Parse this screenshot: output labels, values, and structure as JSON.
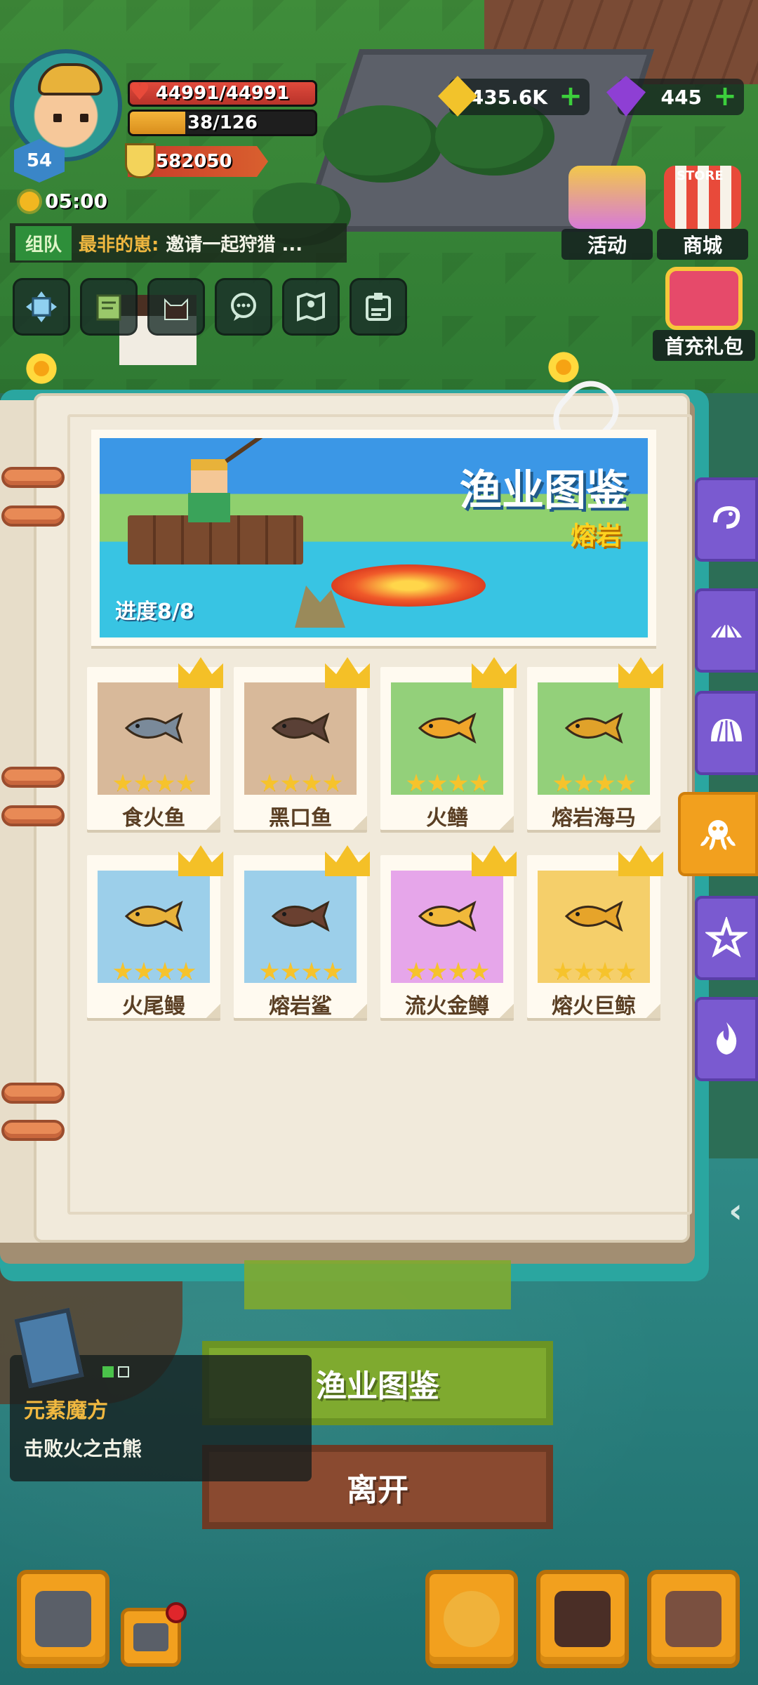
{
  "player": {
    "level": "54",
    "hp": "44991/44991",
    "energy": "38/126",
    "power": "582050",
    "timer": "05:00"
  },
  "currency": {
    "gold": "435.6K",
    "gems": "445"
  },
  "team": {
    "tag": "组队",
    "user": "最非的崽:",
    "message": "邀请一起狩猎 ..."
  },
  "hud_buttons": [
    "scale-icon",
    "map-book-icon",
    "cat-icon",
    "chat-icon",
    "map-icon",
    "badge-icon"
  ],
  "side_shops": {
    "events": "活动",
    "store_sign": "STORE",
    "store": "商城",
    "first_recharge": "首充礼包"
  },
  "journal": {
    "title": "渔业图鉴",
    "subtitle": "熔岩",
    "progress": "进度8/8",
    "fish": [
      {
        "name": "食火鱼",
        "stars": 4,
        "tile": "#d8b99a",
        "fish_color": "#7a8a9a"
      },
      {
        "name": "黑口鱼",
        "stars": 4,
        "tile": "#d8b99a",
        "fish_color": "#5a4036"
      },
      {
        "name": "火鳝",
        "stars": 4,
        "tile": "#93d07a",
        "fish_color": "#f0a52a"
      },
      {
        "name": "熔岩海马",
        "stars": 4,
        "tile": "#93d07a",
        "fish_color": "#e0a22a"
      },
      {
        "name": "火尾鳗",
        "stars": 4,
        "tile": "#9ccfea",
        "fish_color": "#e8b23a"
      },
      {
        "name": "熔岩鲨",
        "stars": 4,
        "tile": "#9ccfea",
        "fish_color": "#6a4030"
      },
      {
        "name": "流火金鳟",
        "stars": 4,
        "tile": "#e6a6ea",
        "fish_color": "#f1b93a"
      },
      {
        "name": "熔火巨鲸",
        "stars": 4,
        "tile": "#f5cf6a",
        "fish_color": "#e6a42a"
      }
    ]
  },
  "side_tabs": [
    {
      "icon": "shrimp-icon",
      "active": false
    },
    {
      "icon": "shell-icon",
      "active": false
    },
    {
      "icon": "scallop-icon",
      "active": false
    },
    {
      "icon": "octopus-icon",
      "active": true
    },
    {
      "icon": "starfish-icon",
      "active": false
    },
    {
      "icon": "flame-icon",
      "active": false
    }
  ],
  "bottom": {
    "journal_button": "渔业图鉴",
    "leave_button": "离开"
  },
  "quest": {
    "title": "元素魔方",
    "description": "击败火之古熊"
  },
  "colors": {
    "active_tab": "#f2a01e",
    "inactive_tab": "#7a5ad0",
    "book_page": "#f1eadb",
    "title_text": "#ffffff",
    "subtitle_text": "#ffd21f"
  }
}
